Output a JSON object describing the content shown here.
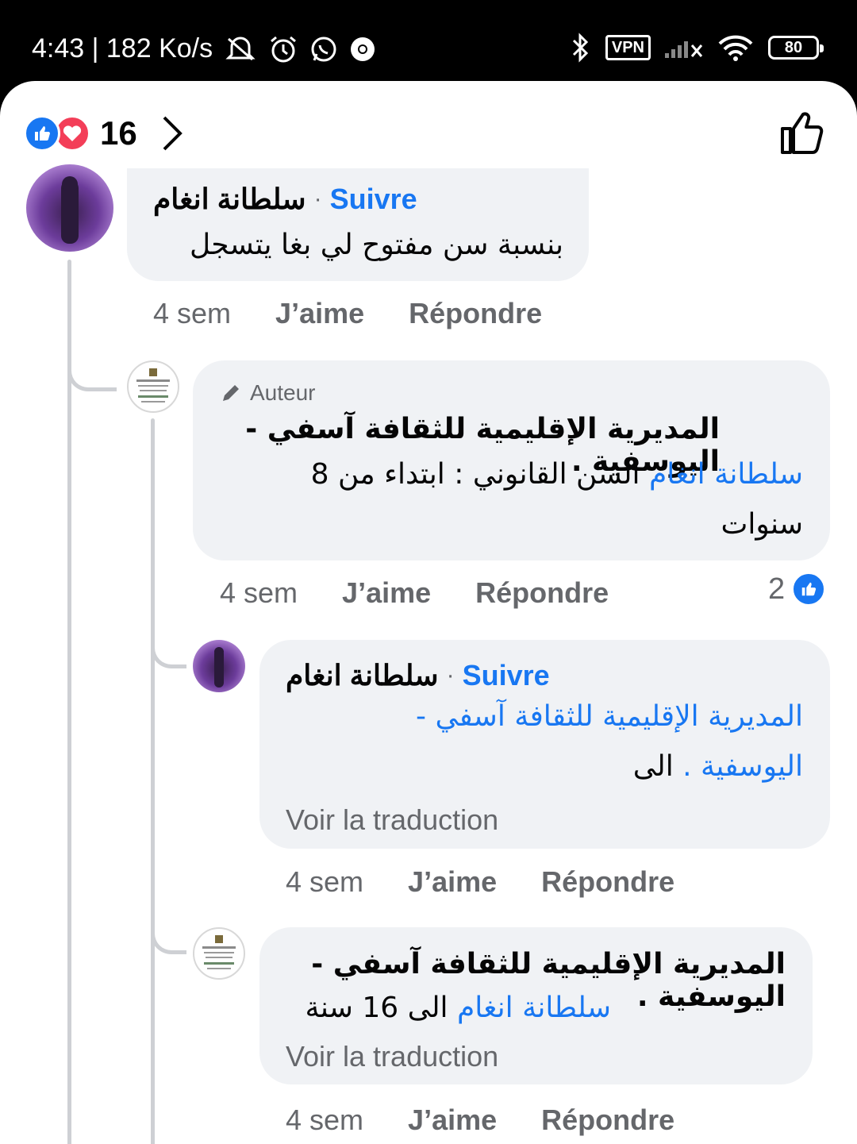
{
  "status_bar": {
    "time_speed": "4:43 | 182 Ko/s",
    "vpn": "VPN",
    "battery": "80"
  },
  "header": {
    "reaction_count": "16"
  },
  "comments": [
    {
      "name": "سلطانة انغام",
      "follow": "Suivre",
      "separator": "·",
      "text": "بنسبة سن مفتوح  لي بغا يتسجل",
      "time": "4 sem",
      "like": "J’aime",
      "reply": "Répondre"
    },
    {
      "author_badge": "Auteur",
      "name": "المديرية الإقليمية للثقافة آسفي - اليوسفية .",
      "mention": "سلطانة انغام",
      "text_after_mention": " السن القانوني : ابتداء من 8",
      "text_line2": "سنوات",
      "time": "4 sem",
      "like": "J’aime",
      "reply": "Répondre",
      "likes": "2"
    },
    {
      "name": "سلطانة انغام",
      "follow": "Suivre",
      "separator": "·",
      "mention_line1": "المديرية الإقليمية للثقافة آسفي -",
      "mention_line2": "اليوسفية .",
      "text_after": " الى",
      "translate": "Voir la traduction",
      "time": "4 sem",
      "like": "J’aime",
      "reply": "Répondre"
    },
    {
      "name": "المديرية الإقليمية للثقافة آسفي - اليوسفية .",
      "mention": "سلطانة انغام",
      "text_after_mention": "  الى 16 سنة",
      "translate": "Voir la traduction",
      "time": "4 sem",
      "like": "J’aime",
      "reply": "Répondre"
    }
  ]
}
